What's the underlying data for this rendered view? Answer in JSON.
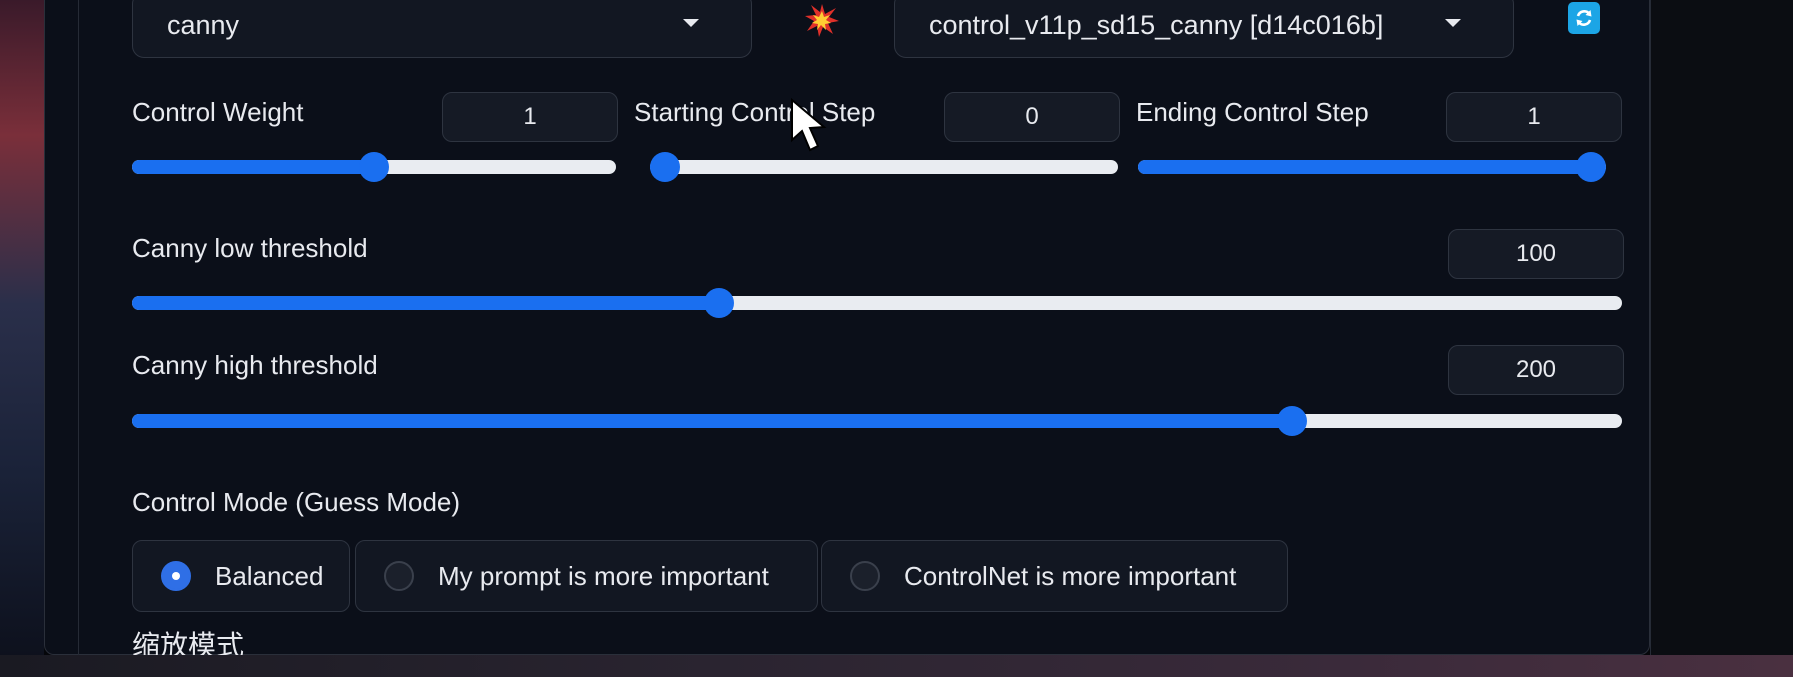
{
  "preprocessor": {
    "value": "canny"
  },
  "model": {
    "value": "control_v11p_sd15_canny [d14c016b]"
  },
  "icons": {
    "run_preprocessor": "spark-icon",
    "refresh_models": "refresh-icon"
  },
  "sliders": {
    "control_weight": {
      "label": "Control Weight",
      "value": "1",
      "fraction": 0.5
    },
    "starting_step": {
      "label": "Starting Control Step",
      "value": "0",
      "fraction": 0.0
    },
    "ending_step": {
      "label": "Ending Control Step",
      "value": "1",
      "fraction": 1.0
    },
    "canny_low": {
      "label": "Canny low threshold",
      "value": "100",
      "fraction": 0.392
    },
    "canny_high": {
      "label": "Canny high threshold",
      "value": "200",
      "fraction": 0.784
    }
  },
  "control_mode": {
    "label": "Control Mode (Guess Mode)",
    "options": [
      "Balanced",
      "My prompt is more important",
      "ControlNet is more important"
    ],
    "selected": "Balanced"
  },
  "resize_mode": {
    "label": "缩放模式"
  },
  "colors": {
    "accent": "#1a6ff0",
    "panel": "#0b0f19",
    "refresh": "#1ca5e6"
  }
}
